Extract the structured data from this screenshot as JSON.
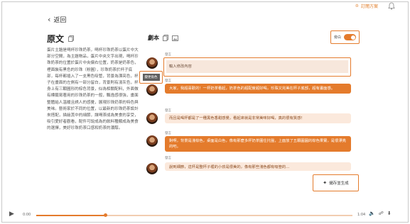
{
  "header": {
    "back_label": "返回",
    "subscription_label": "訂閱方案"
  },
  "original": {
    "title": "原文",
    "text": "蛋片主題是喝杯珍珠奶茶，喝杯珍珠奶茶以蛋片中大部分空間，為主題物品，蛋片中央文字出現，喝杯珍珠奶茶的位置於蛋片中央偏右位置，奶茶是奶茶色，裡面裝有黑色的珍珠（粉圓），珍珠奶茶於杯子底部，每杯都插入了一支黑色吸管，背景為漂亮色，杯子在畫面的左側有一部分留白，背景則有淺灰色，杯身上有三顆圓形的棕色背景，似為相關配料，外面做有標籤寫著用的珍珠奶茶的一般，飄逸感很強，畫面整體給人溫暖且誘人的感覺，展現珍珠奶茶的特色與美味。藝術家於不同的位置，以最新的珍珠奶茶設計來搭配，描繪其中的細節，讓喝茶成為美食的享受，吸引愛好者觀看，配件可說成為的飲料種類成為美食的選擇，美好珍珠奶茶口感和奶茶的濃醇。"
  },
  "script": {
    "title": "劇本",
    "toggle_label": "旁白",
    "role_tag": "變更角色",
    "input_placeholder": "輸入修改內容",
    "save_generate_label": "儲存並生成",
    "messages": [
      {
        "speaker": "發言",
        "text": "",
        "style": "input"
      },
      {
        "speaker": "發言",
        "text": "大家，我超喜歡的！一杯奶茶看起，奶茶色的超配度超好喝，珍珠又完美在杯子底部，超有畫面感。",
        "style": "orange"
      },
      {
        "speaker": "發言",
        "text": "而且是喝杯都是了一種黑色香甜感覺，看起來就是非常美味好喝，真的很有質感！",
        "style": "light"
      },
      {
        "speaker": "發言",
        "text": "對啊，背景是淺棕色，桌面是白色，像有那麼多杯奶茶圍住托盤，上面放了五顆圓圓的棕色果實，是很漂亮的吧。",
        "style": "orange"
      },
      {
        "speaker": "發言",
        "text": "說到細節，這杯是整杯子裡的小孩是很美的，像有那些淺色都有吸管的…",
        "style": "light"
      }
    ]
  },
  "player": {
    "current_time": "0:00",
    "total_time": "1:04",
    "progress": 0.22
  },
  "colors": {
    "accent": "#e47b2c",
    "accent_light": "#fbe9dc"
  }
}
